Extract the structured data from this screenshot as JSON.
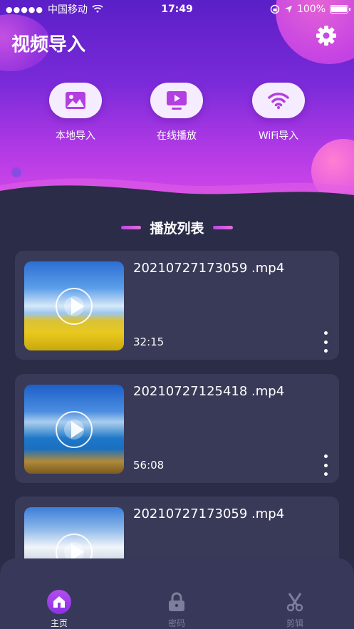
{
  "status_bar": {
    "carrier": "中国移动",
    "time": "17:49",
    "battery": "100%"
  },
  "header": {
    "title": "视频导入",
    "settings_icon": "gear-icon"
  },
  "quick_actions": [
    {
      "label": "本地导入",
      "icon": "image-icon"
    },
    {
      "label": "在线播放",
      "icon": "play-screen-icon"
    },
    {
      "label": "WiFi导入",
      "icon": "wifi-icon"
    }
  ],
  "section": {
    "title": "播放列表"
  },
  "videos": [
    {
      "filename": "20210727173059 .mp4",
      "duration": "32:15"
    },
    {
      "filename": "20210727125418 .mp4",
      "duration": "56:08"
    },
    {
      "filename": "20210727173059 .mp4",
      "duration": ""
    }
  ],
  "tabbar": {
    "items": [
      {
        "label": "主页",
        "icon": "home-icon",
        "active": true
      },
      {
        "label": "密码",
        "icon": "lock-icon",
        "active": false
      },
      {
        "label": "剪辑",
        "icon": "scissors-icon",
        "active": false
      }
    ]
  },
  "colors": {
    "accent": "#a43ee8",
    "background": "#2b2c48",
    "card": "#393a58"
  }
}
